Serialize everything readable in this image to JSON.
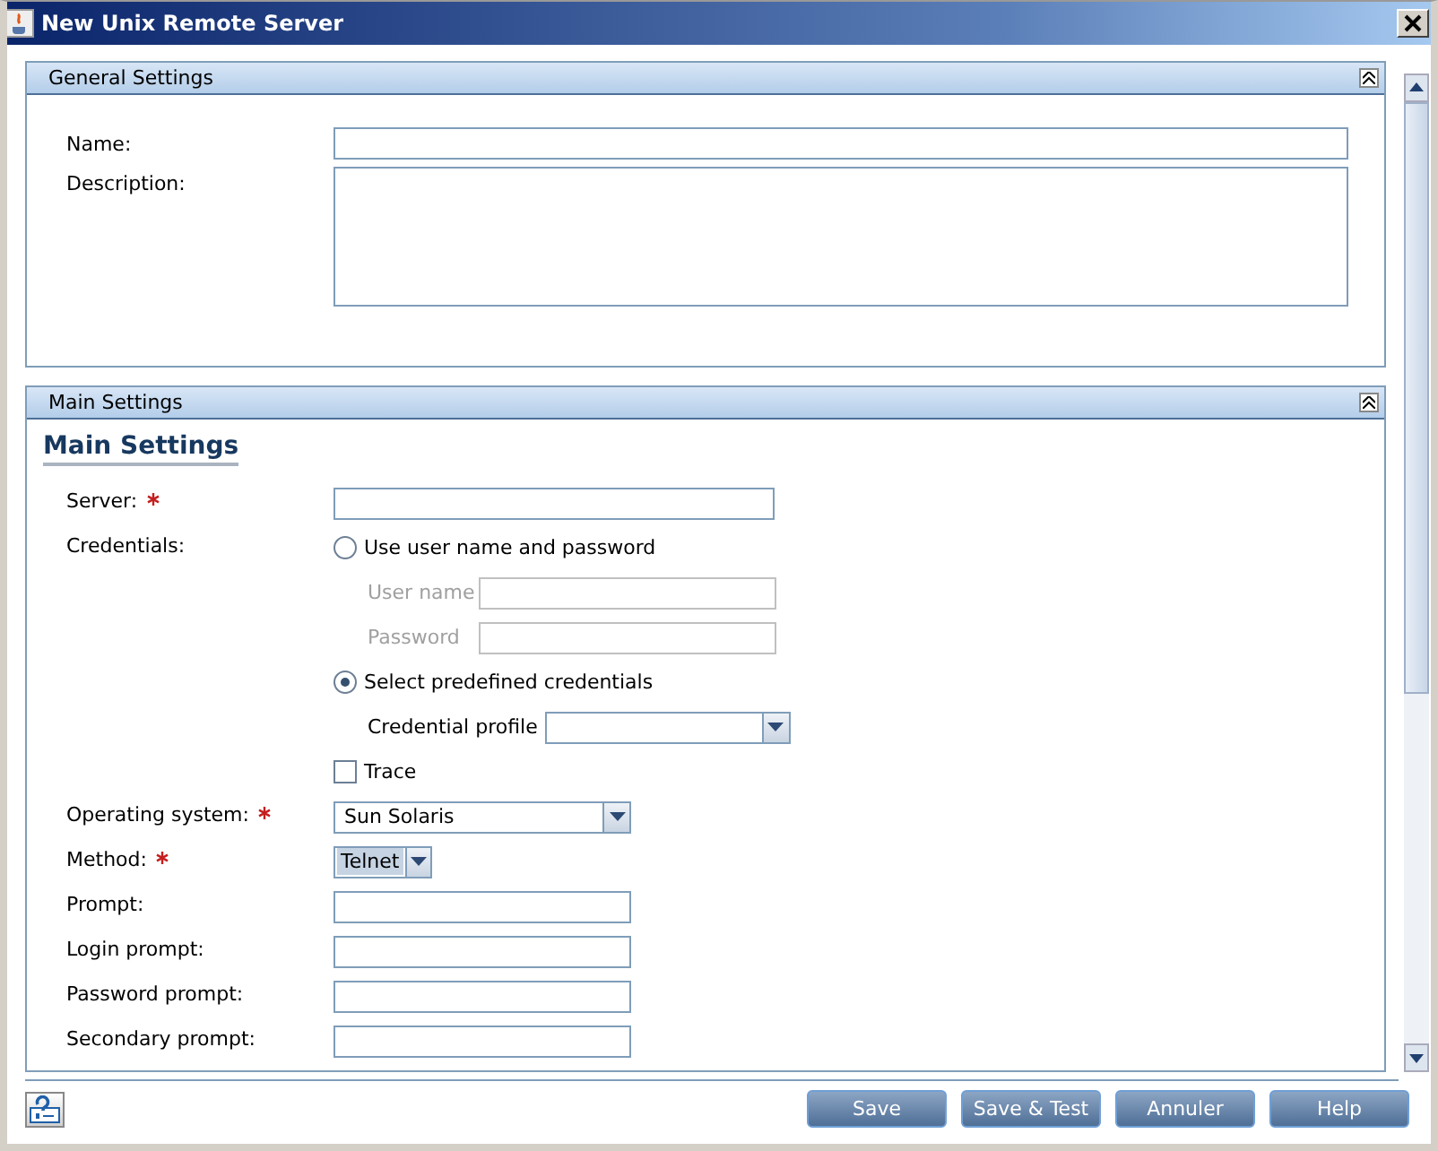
{
  "window": {
    "title": "New Unix Remote Server"
  },
  "general": {
    "title": "General Settings",
    "fields": [
      {
        "label": "Name:",
        "kind": "text"
      },
      {
        "label": "Description:",
        "kind": "textarea"
      }
    ]
  },
  "main": {
    "title": "Main Settings",
    "heading": "Main Settings",
    "server": {
      "label": "Server:",
      "required": true
    },
    "credentials_label": "Credentials:",
    "credential_options": [
      {
        "label": "Use user name and password",
        "selected": false
      },
      {
        "label": "Select predefined credentials",
        "selected": true
      }
    ],
    "user_fields": [
      {
        "label": "User name",
        "disabled": true
      },
      {
        "label": "Password",
        "disabled": true
      }
    ],
    "profile": {
      "label": "Credential profile"
    },
    "trace": {
      "label": "Trace",
      "checked": false
    },
    "rows": [
      {
        "label": "Operating system:",
        "required": true,
        "kind": "select",
        "value": "Sun Solaris"
      },
      {
        "label": "Method:",
        "required": true,
        "kind": "small-select",
        "value": "Telnet"
      },
      {
        "label": "Prompt:",
        "required": false,
        "kind": "text"
      },
      {
        "label": "Login prompt:",
        "required": false,
        "kind": "text"
      },
      {
        "label": "Password prompt:",
        "required": false,
        "kind": "text"
      },
      {
        "label": "Secondary prompt:",
        "required": false,
        "kind": "text"
      }
    ]
  },
  "buttons": [
    {
      "label": "Save"
    },
    {
      "label": "Save & Test"
    },
    {
      "label": "Annuler"
    },
    {
      "label": "Help"
    }
  ]
}
